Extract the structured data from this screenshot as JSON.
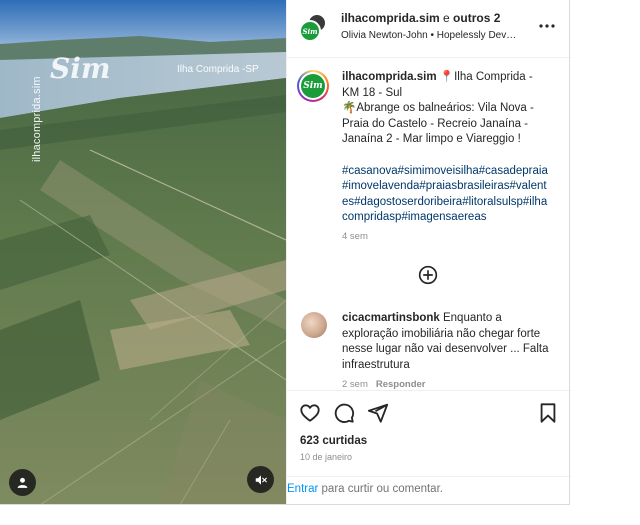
{
  "media": {
    "watermark_handle": "ilhacomprida.sim",
    "watermark_logo": "Sim",
    "watermark_location": "Ilha Comprida -SP",
    "user_tag_icon": "user-tag-icon",
    "mute_icon": "muted-speaker-icon"
  },
  "header": {
    "author": "ilhacomprida.sim",
    "joiner": " e ",
    "collaborators": "outros 2",
    "audio": "Olivia Newton-John • Hopelessly Dev…",
    "more_icon": "more-horizontal-icon"
  },
  "caption": {
    "avatar_text": "Sim",
    "username": "ilhacomprida.sim",
    "line1": " 📍Ilha Comprida - KM 18 - Sul",
    "line2": "🌴Abrange os balneários: Vila Nova - Praia do Castelo - Recreio Janaína - Janaína 2 - Mar limpo e Viareggio !",
    "hashtags": "#casanova#simimoveisilha#casadepraia#imovelavenda#praiasbrasileiras#valentes#dagostoserdoribeira#litoralsulsp#ilhacompridasp#imagensaereas",
    "time": "4 sem"
  },
  "load_more_icon": "plus-circle-icon",
  "comment": {
    "username": "cicacmartinsbonk",
    "text": " Enquanto a exploração imobiliária não chegar forte nesse lugar não vai desenvolver ... Falta infraestrutura",
    "time": "2 sem",
    "reply": "Responder"
  },
  "actions": {
    "like_icon": "heart-icon",
    "comment_icon": "comment-icon",
    "share_icon": "share-icon",
    "save_icon": "bookmark-icon"
  },
  "likes": "623 curtidas",
  "date": "10 de janeiro",
  "login": {
    "link": "Entrar",
    "rest": " para curtir ou comentar."
  },
  "colors": {
    "link_blue": "#0095f6",
    "hashtag_blue": "#00376b",
    "muted_gray": "#8e8e8e",
    "brand_green": "#1a9c3a"
  }
}
